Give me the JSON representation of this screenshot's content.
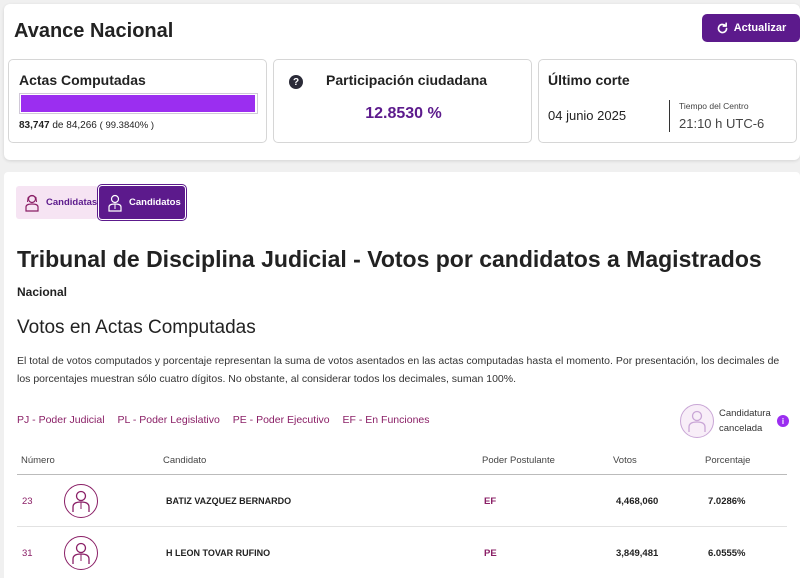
{
  "header": {
    "title": "Avance Nacional",
    "refresh_label": "Actualizar"
  },
  "actas": {
    "title": "Actas Computadas",
    "computed": "83,747",
    "connector": "de",
    "total": "84,266",
    "percent": "( 99.3840% )",
    "progress_fraction": 0.99384
  },
  "participacion": {
    "title": "Participación ciudadana",
    "value": "12.8530 %"
  },
  "corte": {
    "title": "Último corte",
    "date": "04 junio 2025",
    "tz_label": "Tiempo del Centro",
    "time": "21:10 h UTC-6"
  },
  "tabs": [
    {
      "label": "Candidatas",
      "active": false
    },
    {
      "label": "Candidatos",
      "active": true
    }
  ],
  "main": {
    "title": "Tribunal de Disciplina Judicial - Votos por candidatos a Magistrados",
    "scope": "Nacional",
    "votos_title": "Votos en Actas Computadas",
    "description": "El total de votos computados y porcentaje representan la suma de votos asentados en las actas computadas hasta el momento. Por presentación, los decimales de los porcentajes muestran sólo cuatro dígitos. No obstante, al considerar todos los decimales, suman 100%."
  },
  "legend": [
    "PJ - Poder Judicial",
    "PL - Poder Legislativo",
    "PE - Poder Ejecutivo",
    "EF - En Funciones"
  ],
  "cancelada": {
    "line1": "Candidatura",
    "line2": "cancelada"
  },
  "table": {
    "headers": [
      "Número",
      "Candidato",
      "Poder Postulante",
      "Votos",
      "Porcentaje"
    ],
    "rows": [
      {
        "numero": "23",
        "candidato": "BATIZ VAZQUEZ BERNARDO",
        "poder": "EF",
        "votos": "4,468,060",
        "porcentaje": "7.0286%"
      },
      {
        "numero": "31",
        "candidato": "H LEON TOVAR RUFINO",
        "poder": "PE",
        "votos": "3,849,481",
        "porcentaje": "6.0555%"
      }
    ]
  },
  "colors": {
    "primary": "#5c1a8c",
    "accent": "#9b2ef0",
    "link": "#8a1f66"
  }
}
